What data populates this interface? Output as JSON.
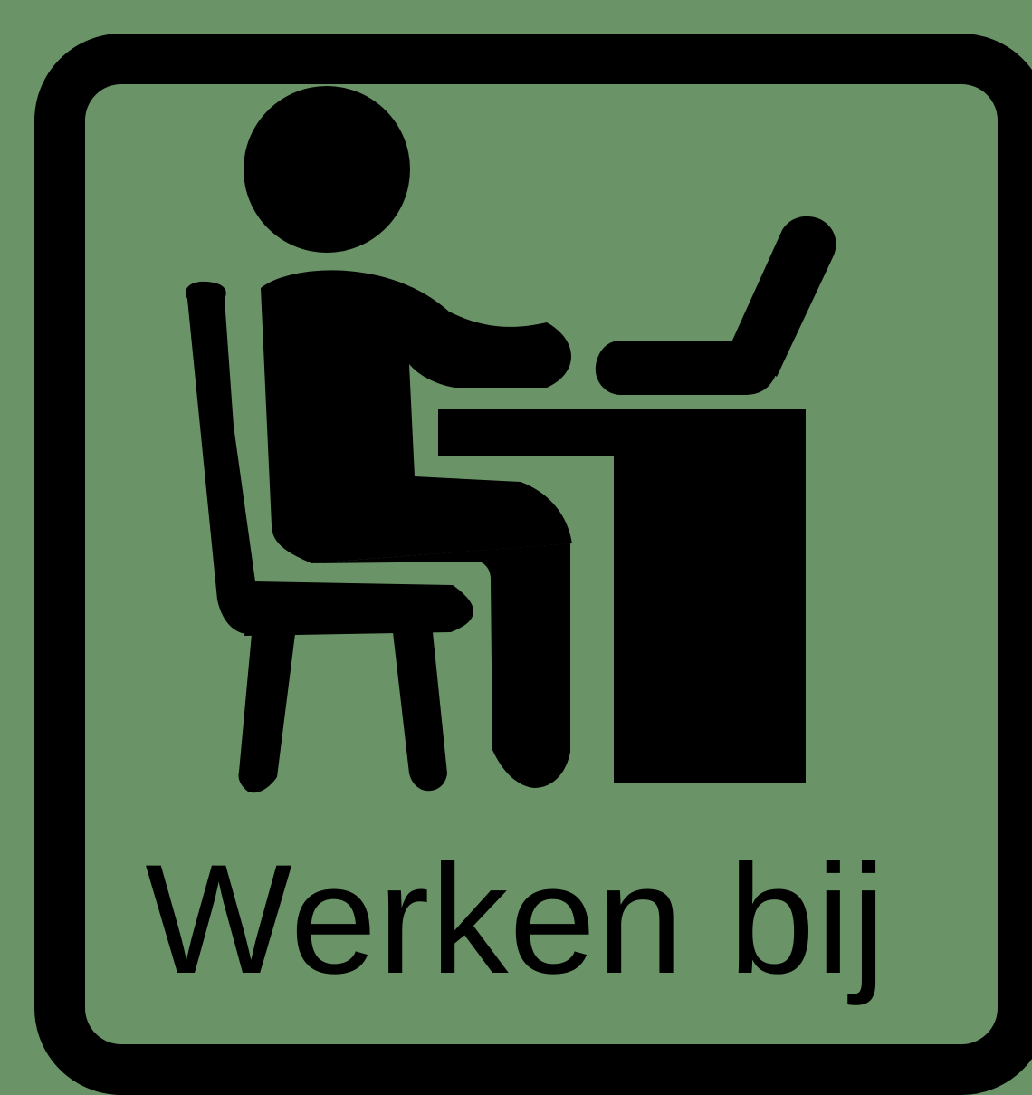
{
  "sign": {
    "label": "Werken bij",
    "background_color": "#6a9467",
    "foreground_color": "#000000",
    "icon": "person-at-desk-with-laptop-icon"
  }
}
